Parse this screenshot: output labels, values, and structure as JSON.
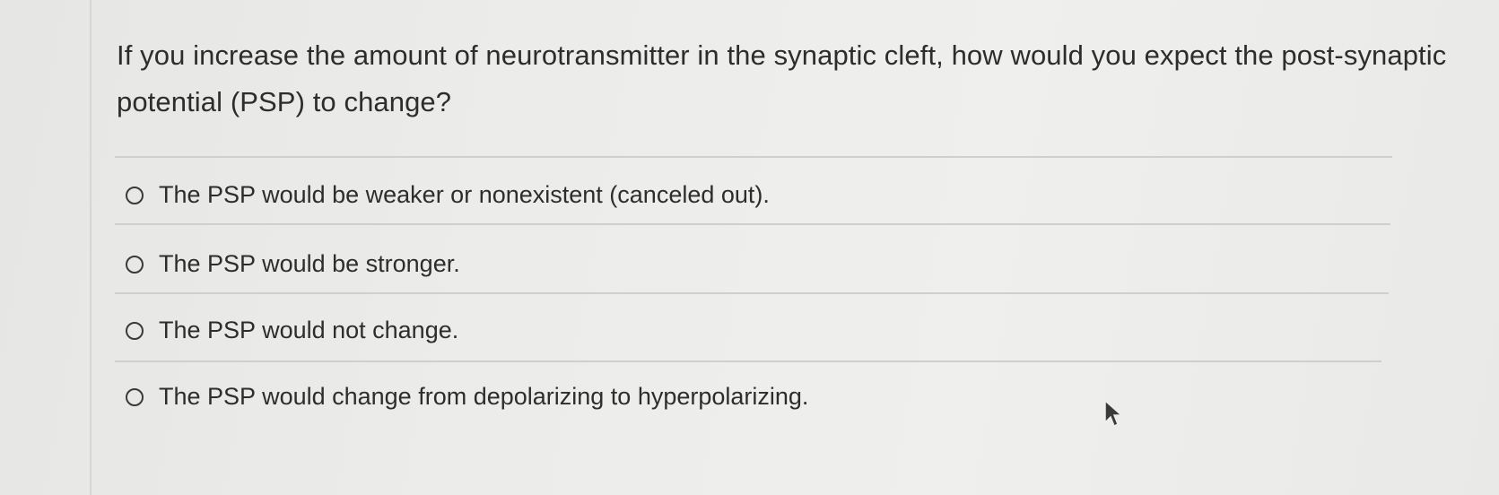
{
  "question": {
    "text": "If you increase the amount of neurotransmitter in the synaptic cleft, how would you expect the post-synaptic potential (PSP) to change?"
  },
  "options": [
    {
      "label": "The PSP would be weaker or nonexistent (canceled out).",
      "selected": false
    },
    {
      "label": "The PSP would be stronger.",
      "selected": false
    },
    {
      "label": "The PSP would not change.",
      "selected": false
    },
    {
      "label": "The PSP would change from depolarizing to hyperpolarizing.",
      "selected": false
    }
  ],
  "icons": {
    "radio": "radio-circle-icon",
    "cursor": "mouse-pointer-icon"
  },
  "colors": {
    "background": "#ececea",
    "text": "#2d2d2d",
    "divider": "#cfcfcd"
  }
}
